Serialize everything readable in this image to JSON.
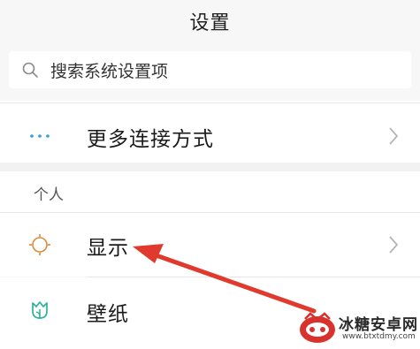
{
  "header": {
    "title": "设置"
  },
  "search": {
    "placeholder": "搜索系统设置项",
    "icon": "search-icon"
  },
  "rows": {
    "more_connections": {
      "label": "更多连接方式",
      "icon": "more-dots-icon"
    },
    "display": {
      "label": "显示",
      "icon": "brightness-icon"
    },
    "wallpaper": {
      "label": "壁纸",
      "icon": "tulip-icon"
    }
  },
  "sections": {
    "personal": "个人"
  },
  "watermark": {
    "name": "冰糖安卓网",
    "url": "www.btxtdmy.com"
  },
  "colors": {
    "accent_orange": "#d98a3a",
    "accent_teal": "#2bb39a",
    "more_dots_blue": "#3a9fd0",
    "arrow_red": "#e03a2e",
    "chevron": "#b5b5b5"
  }
}
